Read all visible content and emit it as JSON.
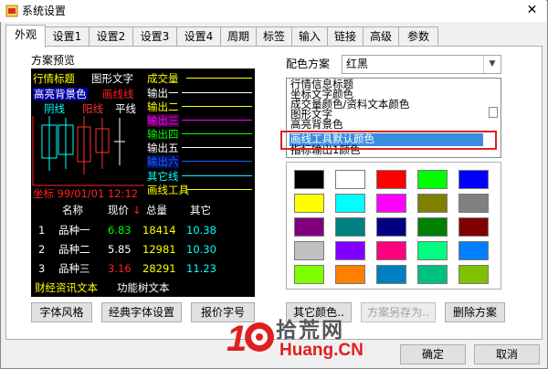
{
  "window": {
    "title": "系统设置",
    "close_glyph": "✕"
  },
  "tabs": [
    {
      "label": "外观",
      "active": true
    },
    {
      "label": "设置1"
    },
    {
      "label": "设置2"
    },
    {
      "label": "设置3"
    },
    {
      "label": "设置4"
    },
    {
      "label": "周期"
    },
    {
      "label": "标签"
    },
    {
      "label": "输入"
    },
    {
      "label": "链接"
    },
    {
      "label": "高级"
    },
    {
      "label": "参数"
    }
  ],
  "scheme_preview_label": "方案预览",
  "preview": {
    "title_text": "行情标题",
    "graph_text": "图形文字",
    "highlight_bg": "高亮背景色",
    "draw_line": "画线线",
    "yin_line": "阴线",
    "yang_line": "阳线",
    "flat_line": "平线",
    "volume": "成交量",
    "outputs": [
      "输出一",
      "输出二",
      "输出三",
      "输出四",
      "输出五",
      "输出六"
    ],
    "other_line": "其它线",
    "draw_tool": "画线工具",
    "coord_text": "坐标 99/01/01 12:12",
    "headers": [
      "名称",
      "现价",
      "总量",
      "其它"
    ],
    "arrow_down": "↓",
    "rows": [
      {
        "idx": "1",
        "name": "品种一",
        "price": "6.83",
        "vol": "18414",
        "other": "10.38"
      },
      {
        "idx": "2",
        "name": "品种二",
        "price": "5.85",
        "vol": "12981",
        "other": "10.30"
      },
      {
        "idx": "3",
        "name": "品种三",
        "price": "3.16",
        "vol": "28291",
        "other": "11.23"
      }
    ],
    "finance_text": "财经资讯文本",
    "func_tree_text": "功能树文本"
  },
  "scheme": {
    "label": "配色方案",
    "value": "红黑"
  },
  "element_list": [
    "行情信息标题",
    "坐标文字颜色",
    "成交量颜色/资料文本颜色",
    "图形文字",
    "高亮背景色",
    "画线工具默认颜色",
    "指标输出1颜色"
  ],
  "selected_item_index": 5,
  "palette_colors": [
    "#000000",
    "#ffffff",
    "#ff0000",
    "#00ff00",
    "#0000ff",
    "#ffff00",
    "#00ffff",
    "#ff00ff",
    "#808000",
    "#808080",
    "#800080",
    "#008080",
    "#000080",
    "#008000",
    "#800000",
    "#c0c0c0",
    "#8000ff",
    "#ff0080",
    "#00ff80",
    "#0080ff",
    "#80ff00",
    "#ff8000",
    "#0080c0",
    "#00c080",
    "#80c000"
  ],
  "buttons": {
    "font_style": "字体风格",
    "classic_font": "经典字体设置",
    "quote_font": "报价字号",
    "other_colors": "其它颜色..",
    "save_as": "方案另存为..",
    "delete_scheme": "删除方案",
    "ok": "确定",
    "cancel": "取消"
  },
  "watermark": {
    "big": "10",
    "cn": "拾荒网",
    "url": "Huang.CN"
  }
}
